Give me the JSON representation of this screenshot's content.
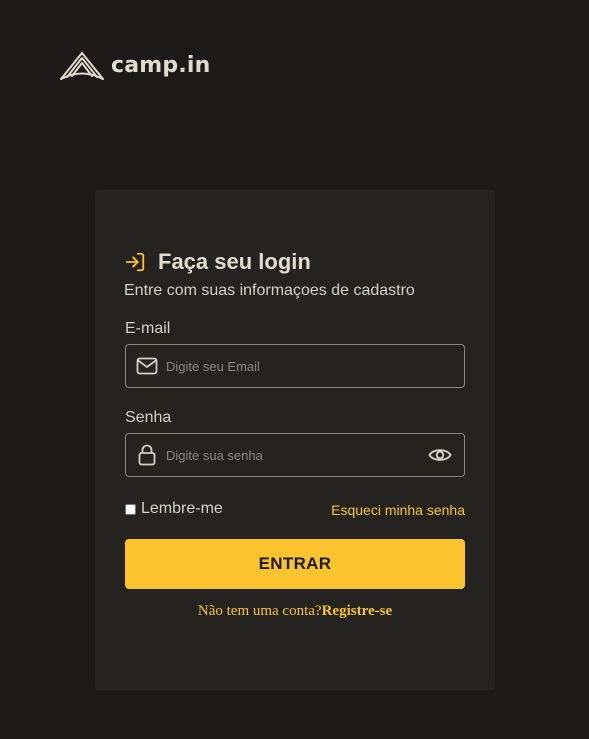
{
  "brand": {
    "name": "camp.in",
    "logo_icon": "tent-icon"
  },
  "login": {
    "title": "Faça seu login",
    "title_icon": "sign-in-icon",
    "subtitle": "Entre com suas informaçoes de cadastro",
    "email": {
      "label": "E-mail",
      "placeholder": "Digite seu Email",
      "value": "",
      "icon": "mail-icon"
    },
    "password": {
      "label": "Senha",
      "placeholder": "Digite sua senha",
      "value": "",
      "icon": "lock-icon",
      "toggle_icon": "eye-icon"
    },
    "remember_label": "Lembre-me",
    "remember_checked": false,
    "forgot_label": "Esqueci minha senha",
    "submit_label": "ENTRAR",
    "signup_prompt": "Não tem uma conta?",
    "signup_link": "Registre-se"
  },
  "colors": {
    "background": "#1b1a18",
    "card": "#242320",
    "accent": "#fbc42e",
    "text": "#d4d0c6",
    "heading": "#e1dccb"
  }
}
